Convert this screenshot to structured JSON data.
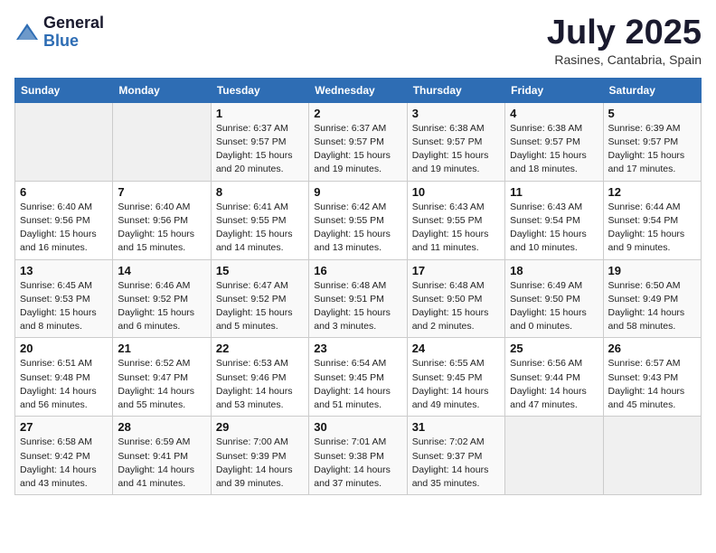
{
  "header": {
    "logo_general": "General",
    "logo_blue": "Blue",
    "month_title": "July 2025",
    "location": "Rasines, Cantabria, Spain"
  },
  "days": [
    "Sunday",
    "Monday",
    "Tuesday",
    "Wednesday",
    "Thursday",
    "Friday",
    "Saturday"
  ],
  "weeks": [
    [
      {
        "date": "",
        "info": ""
      },
      {
        "date": "",
        "info": ""
      },
      {
        "date": "1",
        "info": "Sunrise: 6:37 AM\nSunset: 9:57 PM\nDaylight: 15 hours\nand 20 minutes."
      },
      {
        "date": "2",
        "info": "Sunrise: 6:37 AM\nSunset: 9:57 PM\nDaylight: 15 hours\nand 19 minutes."
      },
      {
        "date": "3",
        "info": "Sunrise: 6:38 AM\nSunset: 9:57 PM\nDaylight: 15 hours\nand 19 minutes."
      },
      {
        "date": "4",
        "info": "Sunrise: 6:38 AM\nSunset: 9:57 PM\nDaylight: 15 hours\nand 18 minutes."
      },
      {
        "date": "5",
        "info": "Sunrise: 6:39 AM\nSunset: 9:57 PM\nDaylight: 15 hours\nand 17 minutes."
      }
    ],
    [
      {
        "date": "6",
        "info": "Sunrise: 6:40 AM\nSunset: 9:56 PM\nDaylight: 15 hours\nand 16 minutes."
      },
      {
        "date": "7",
        "info": "Sunrise: 6:40 AM\nSunset: 9:56 PM\nDaylight: 15 hours\nand 15 minutes."
      },
      {
        "date": "8",
        "info": "Sunrise: 6:41 AM\nSunset: 9:55 PM\nDaylight: 15 hours\nand 14 minutes."
      },
      {
        "date": "9",
        "info": "Sunrise: 6:42 AM\nSunset: 9:55 PM\nDaylight: 15 hours\nand 13 minutes."
      },
      {
        "date": "10",
        "info": "Sunrise: 6:43 AM\nSunset: 9:55 PM\nDaylight: 15 hours\nand 11 minutes."
      },
      {
        "date": "11",
        "info": "Sunrise: 6:43 AM\nSunset: 9:54 PM\nDaylight: 15 hours\nand 10 minutes."
      },
      {
        "date": "12",
        "info": "Sunrise: 6:44 AM\nSunset: 9:54 PM\nDaylight: 15 hours\nand 9 minutes."
      }
    ],
    [
      {
        "date": "13",
        "info": "Sunrise: 6:45 AM\nSunset: 9:53 PM\nDaylight: 15 hours\nand 8 minutes."
      },
      {
        "date": "14",
        "info": "Sunrise: 6:46 AM\nSunset: 9:52 PM\nDaylight: 15 hours\nand 6 minutes."
      },
      {
        "date": "15",
        "info": "Sunrise: 6:47 AM\nSunset: 9:52 PM\nDaylight: 15 hours\nand 5 minutes."
      },
      {
        "date": "16",
        "info": "Sunrise: 6:48 AM\nSunset: 9:51 PM\nDaylight: 15 hours\nand 3 minutes."
      },
      {
        "date": "17",
        "info": "Sunrise: 6:48 AM\nSunset: 9:50 PM\nDaylight: 15 hours\nand 2 minutes."
      },
      {
        "date": "18",
        "info": "Sunrise: 6:49 AM\nSunset: 9:50 PM\nDaylight: 15 hours\nand 0 minutes."
      },
      {
        "date": "19",
        "info": "Sunrise: 6:50 AM\nSunset: 9:49 PM\nDaylight: 14 hours\nand 58 minutes."
      }
    ],
    [
      {
        "date": "20",
        "info": "Sunrise: 6:51 AM\nSunset: 9:48 PM\nDaylight: 14 hours\nand 56 minutes."
      },
      {
        "date": "21",
        "info": "Sunrise: 6:52 AM\nSunset: 9:47 PM\nDaylight: 14 hours\nand 55 minutes."
      },
      {
        "date": "22",
        "info": "Sunrise: 6:53 AM\nSunset: 9:46 PM\nDaylight: 14 hours\nand 53 minutes."
      },
      {
        "date": "23",
        "info": "Sunrise: 6:54 AM\nSunset: 9:45 PM\nDaylight: 14 hours\nand 51 minutes."
      },
      {
        "date": "24",
        "info": "Sunrise: 6:55 AM\nSunset: 9:45 PM\nDaylight: 14 hours\nand 49 minutes."
      },
      {
        "date": "25",
        "info": "Sunrise: 6:56 AM\nSunset: 9:44 PM\nDaylight: 14 hours\nand 47 minutes."
      },
      {
        "date": "26",
        "info": "Sunrise: 6:57 AM\nSunset: 9:43 PM\nDaylight: 14 hours\nand 45 minutes."
      }
    ],
    [
      {
        "date": "27",
        "info": "Sunrise: 6:58 AM\nSunset: 9:42 PM\nDaylight: 14 hours\nand 43 minutes."
      },
      {
        "date": "28",
        "info": "Sunrise: 6:59 AM\nSunset: 9:41 PM\nDaylight: 14 hours\nand 41 minutes."
      },
      {
        "date": "29",
        "info": "Sunrise: 7:00 AM\nSunset: 9:39 PM\nDaylight: 14 hours\nand 39 minutes."
      },
      {
        "date": "30",
        "info": "Sunrise: 7:01 AM\nSunset: 9:38 PM\nDaylight: 14 hours\nand 37 minutes."
      },
      {
        "date": "31",
        "info": "Sunrise: 7:02 AM\nSunset: 9:37 PM\nDaylight: 14 hours\nand 35 minutes."
      },
      {
        "date": "",
        "info": ""
      },
      {
        "date": "",
        "info": ""
      }
    ]
  ]
}
